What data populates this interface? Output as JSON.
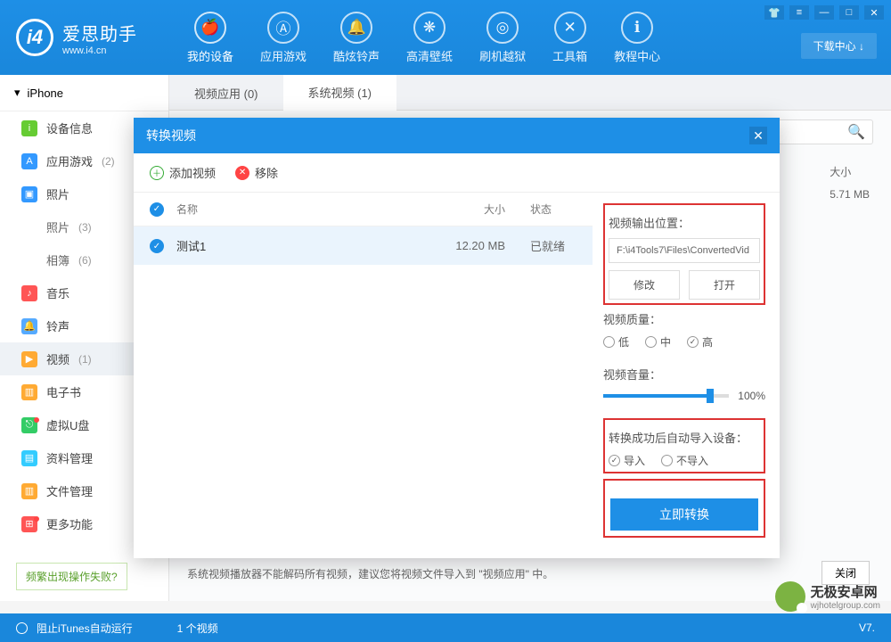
{
  "header": {
    "logo_cn": "爱思助手",
    "logo_en": "www.i4.cn",
    "nav": [
      {
        "label": "我的设备"
      },
      {
        "label": "应用游戏"
      },
      {
        "label": "酷炫铃声"
      },
      {
        "label": "高清壁纸"
      },
      {
        "label": "刷机越狱"
      },
      {
        "label": "工具箱"
      },
      {
        "label": "教程中心"
      }
    ],
    "download_center": "下载中心 ↓"
  },
  "sidebar": {
    "device": "iPhone",
    "items": [
      {
        "icon_bg": "#6c3",
        "label": "设备信息",
        "count": ""
      },
      {
        "icon_bg": "#39f",
        "label": "应用游戏",
        "count": "(2)"
      },
      {
        "icon_bg": "#39f",
        "label": "照片",
        "count": ""
      },
      {
        "icon_bg": "",
        "label": "照片",
        "count": "(3)",
        "sub": true
      },
      {
        "icon_bg": "",
        "label": "相簿",
        "count": "(6)",
        "sub": true
      },
      {
        "icon_bg": "#f55",
        "label": "音乐",
        "count": ""
      },
      {
        "icon_bg": "#5af",
        "label": "铃声",
        "count": ""
      },
      {
        "icon_bg": "#fa3",
        "label": "视频",
        "count": "(1)",
        "active": true
      },
      {
        "icon_bg": "#fa3",
        "label": "电子书",
        "count": ""
      },
      {
        "icon_bg": "#3c6",
        "label": "虚拟U盘",
        "count": "",
        "dot": true
      },
      {
        "icon_bg": "#3cf",
        "label": "资料管理",
        "count": ""
      },
      {
        "icon_bg": "#fa3",
        "label": "文件管理",
        "count": ""
      },
      {
        "icon_bg": "#f55",
        "label": "更多功能",
        "count": "",
        "dot": true
      }
    ],
    "help": "频繁出现操作失败?"
  },
  "content": {
    "tabs": [
      {
        "label": "视频应用 (0)"
      },
      {
        "label": "系统视频 (1)",
        "active": true
      }
    ],
    "size_header": "大小",
    "size_value": "5.71 MB",
    "hint": "系统视频播放器不能解码所有视频，建议您将视频文件导入到 \"视频应用\" 中。",
    "close": "关闭"
  },
  "dialog": {
    "title": "转换视频",
    "add": "添加视频",
    "remove": "移除",
    "cols": {
      "name": "名称",
      "size": "大小",
      "status": "状态"
    },
    "rows": [
      {
        "name": "测试1",
        "size": "12.20 MB",
        "status": "已就绪"
      }
    ],
    "output_label": "视频输出位置：",
    "output_path": "F:\\i4Tools7\\Files\\ConvertedVid",
    "modify": "修改",
    "open": "打开",
    "quality_label": "视频质量：",
    "quality": {
      "low": "低",
      "mid": "中",
      "high": "高"
    },
    "volume_label": "视频音量：",
    "volume_val": "100%",
    "auto_label": "转换成功后自动导入设备：",
    "auto": {
      "yes": "导入",
      "no": "不导入"
    },
    "convert": "立即转换"
  },
  "footer": {
    "itunes": "阻止iTunes自动运行",
    "count": "1 个视频",
    "ver": "V7."
  },
  "watermark": {
    "l1": "无极安卓网",
    "l2": "wjhotelgroup.com"
  }
}
